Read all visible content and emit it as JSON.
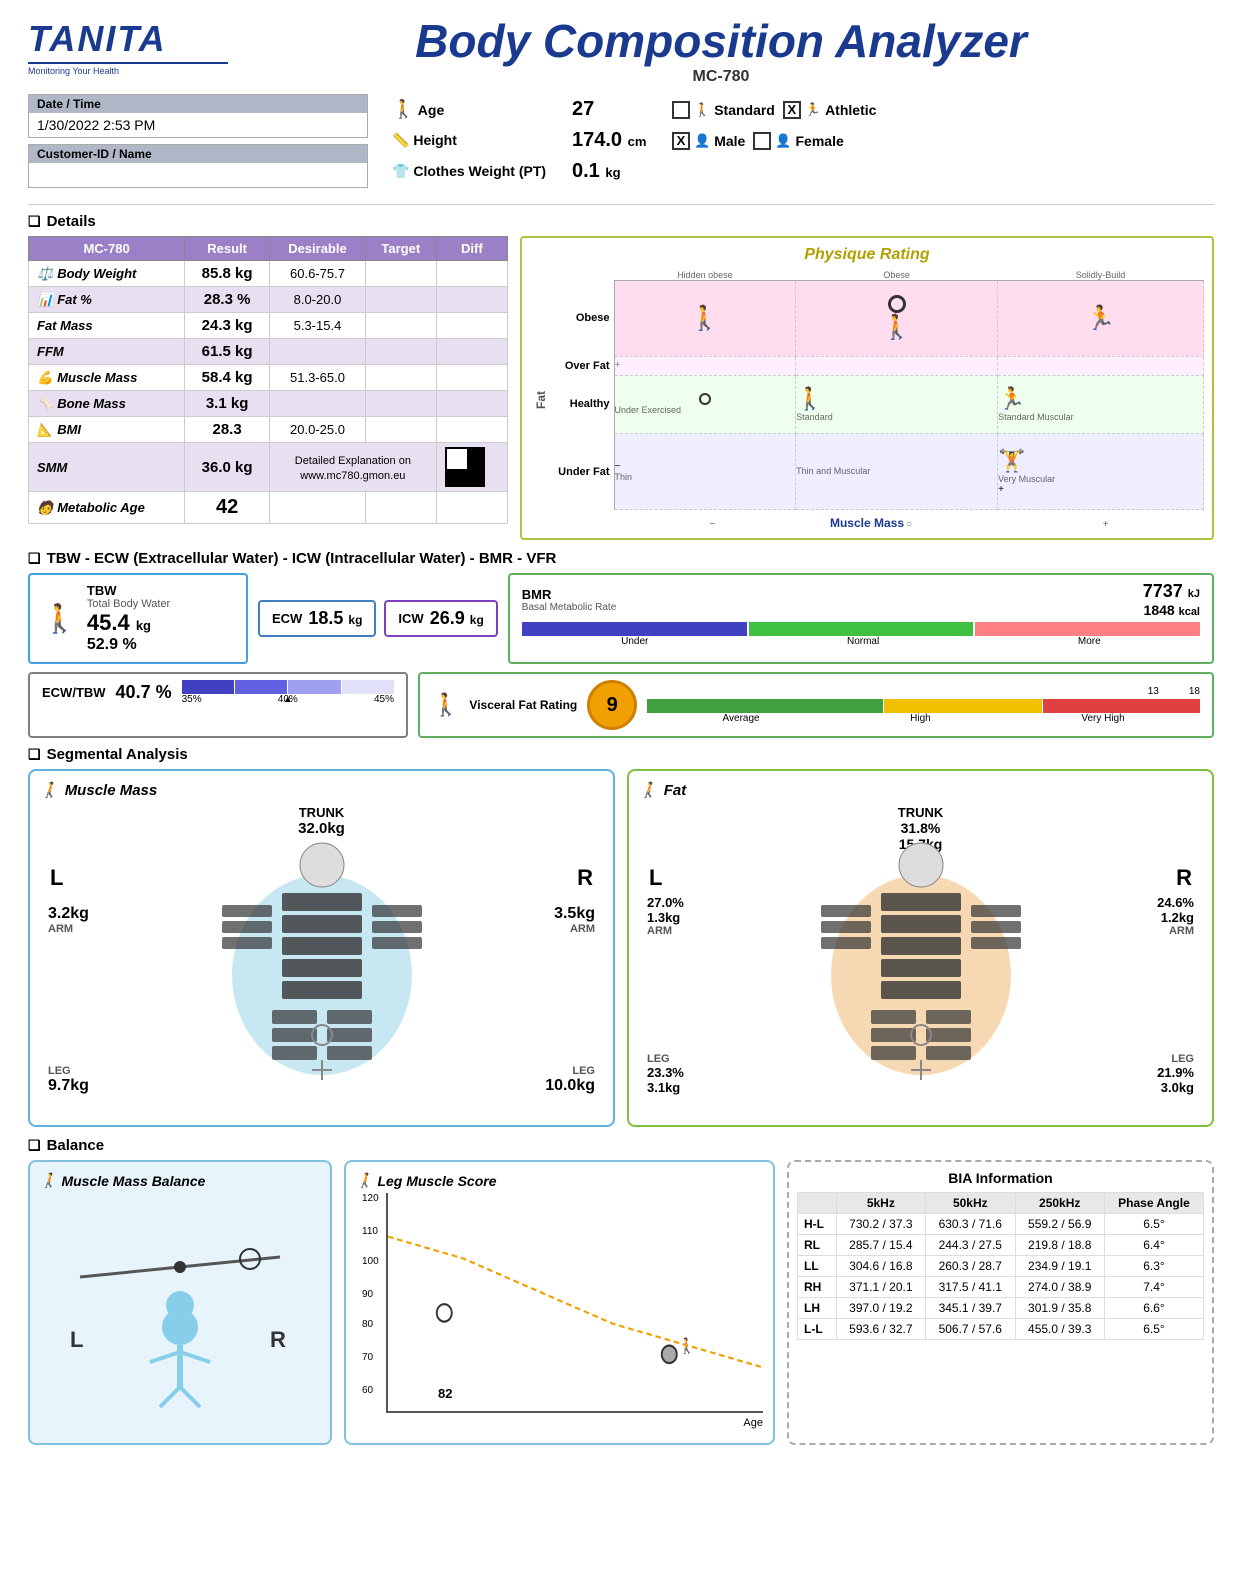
{
  "header": {
    "brand": "TANITA",
    "brand_sub": "Monitoring Your Health",
    "title": "Body Composition Analyzer",
    "model": "MC-780"
  },
  "info": {
    "date_label": "Date / Time",
    "date_value": "1/30/2022 2:53 PM",
    "customer_label": "Customer-ID / Name",
    "customer_value": "",
    "age_label": "Age",
    "age_value": "27",
    "height_label": "Height",
    "height_value": "174.0",
    "height_unit": "cm",
    "clothes_label": "Clothes Weight (PT)",
    "clothes_value": "0.1",
    "clothes_unit": "kg",
    "standard_label": "Standard",
    "athletic_label": "Athletic",
    "male_label": "Male",
    "female_label": "Female",
    "standard_checked": false,
    "athletic_checked": true,
    "male_checked": true,
    "female_checked": false
  },
  "details": {
    "section_title": "Details",
    "columns": [
      "MC-780",
      "Result",
      "Desirable",
      "Target",
      "Diff"
    ],
    "rows": [
      {
        "label": "Body Weight",
        "icon": "weight-icon",
        "result": "85.8 kg",
        "desirable": "60.6-75.7",
        "target": "",
        "diff": ""
      },
      {
        "label": "Fat %",
        "icon": "fat-pct-icon",
        "result": "28.3 %",
        "desirable": "8.0-20.0",
        "target": "",
        "diff": ""
      },
      {
        "label": "Fat Mass",
        "icon": "fat-mass-icon",
        "result": "24.3 kg",
        "desirable": "5.3-15.4",
        "target": "",
        "diff": ""
      },
      {
        "label": "FFM",
        "icon": "ffm-icon",
        "result": "61.5 kg",
        "desirable": "",
        "target": "",
        "diff": ""
      },
      {
        "label": "Muscle Mass",
        "icon": "muscle-icon",
        "result": "58.4 kg",
        "desirable": "51.3-65.0",
        "target": "",
        "diff": ""
      },
      {
        "label": "Bone Mass",
        "icon": "bone-icon",
        "result": "3.1 kg",
        "desirable": "",
        "target": "",
        "diff": ""
      },
      {
        "label": "BMI",
        "icon": "bmi-icon",
        "result": "28.3",
        "desirable": "20.0-25.0",
        "target": "",
        "diff": ""
      },
      {
        "label": "SMM",
        "icon": "smm-icon",
        "result": "36.0 kg",
        "desirable": "",
        "target": "",
        "diff": ""
      },
      {
        "label": "Metabolic Age",
        "icon": "age-icon",
        "result": "42",
        "desirable": "",
        "target": "",
        "diff": ""
      }
    ],
    "qr_note": "Detailed Explanation on www.mc780.gmon.eu"
  },
  "physique": {
    "title": "Physique Rating",
    "y_labels": [
      "Obese",
      "Over Fat",
      "Healthy",
      "Under Fat"
    ],
    "x_labels": [
      "Thin",
      "Thin and Muscular",
      "Very Muscular"
    ],
    "x_labels_top": [
      "Hidden obese",
      "Obese",
      "Solidly-Build"
    ],
    "marker_col": 2,
    "marker_row": 0,
    "fat_label": "Fat",
    "muscle_label": "Muscle Mass"
  },
  "tbw": {
    "section_title": "TBW - ECW (Extracellular Water) - ICW (Intracellular Water) - BMR - VFR",
    "tbw_label": "TBW",
    "tbw_sub": "Total Body Water",
    "tbw_value": "45.4",
    "tbw_unit": "kg",
    "tbw_pct": "52.9",
    "tbw_pct_unit": "%",
    "ecw_label": "ECW",
    "ecw_value": "18.5",
    "ecw_unit": "kg",
    "icw_label": "ICW",
    "icw_value": "26.9",
    "icw_unit": "kg",
    "bmr_label": "BMR",
    "bmr_sub": "Basal Metabolic Rate",
    "bmr_value": "7737",
    "bmr_unit": "kJ",
    "bmr_kcal": "1848",
    "bmr_kcal_unit": "kcal",
    "bmr_bar_labels": [
      "Under",
      "Normal",
      "More"
    ],
    "ecwtbw_label": "ECW/TBW",
    "ecwtbw_value": "40.7",
    "ecwtbw_unit": "%",
    "ecwtbw_bar_labels": [
      "35%",
      "40%",
      "45%"
    ],
    "visceral_label": "Visceral Fat Rating",
    "visceral_value": "9",
    "visceral_bar_markers": [
      "13",
      "18"
    ],
    "visceral_bar_labels": [
      "Average",
      "High",
      "Very High"
    ]
  },
  "segmental": {
    "section_title": "Segmental Analysis",
    "muscle_title": "Muscle Mass",
    "fat_title": "Fat",
    "trunk_label": "TRUNK",
    "l_label": "L",
    "r_label": "R",
    "arm_label": "ARM",
    "leg_label": "LEG",
    "muscle": {
      "trunk_value": "32.0kg",
      "left_arm": "3.2kg",
      "right_arm": "3.5kg",
      "left_leg": "9.7kg",
      "right_leg": "10.0kg"
    },
    "fat": {
      "trunk_pct": "31.8%",
      "trunk_value": "15.7kg",
      "left_arm_pct": "27.0%",
      "left_arm": "1.3kg",
      "right_arm_pct": "24.6%",
      "right_arm": "1.2kg",
      "left_leg_pct": "23.3%",
      "left_leg": "3.1kg",
      "right_leg_pct": "21.9%",
      "right_leg": "3.0kg"
    }
  },
  "balance": {
    "section_title": "Balance",
    "muscle_balance_title": "Muscle Mass Balance",
    "leg_score_title": "Leg Muscle Score",
    "leg_score_value": "82",
    "leg_chart_y_labels": [
      "60",
      "70",
      "80",
      "90",
      "100",
      "110",
      "120"
    ],
    "bia_title": "BIA Information",
    "bia_columns": [
      "5kHz",
      "50kHz",
      "250kHz",
      "Phase Angle"
    ],
    "bia_rows": [
      {
        "label": "H-L",
        "v5": "730.2 / 37.3",
        "v50": "630.3 / 71.6",
        "v250": "559.2 / 56.9",
        "phase": "6.5°"
      },
      {
        "label": "RL",
        "v5": "285.7 / 15.4",
        "v50": "244.3 / 27.5",
        "v250": "219.8 / 18.8",
        "phase": "6.4°"
      },
      {
        "label": "LL",
        "v5": "304.6 / 16.8",
        "v50": "260.3 / 28.7",
        "v250": "234.9 / 19.1",
        "phase": "6.3°"
      },
      {
        "label": "RH",
        "v5": "371.1 / 20.1",
        "v50": "317.5 / 41.1",
        "v250": "274.0 / 38.9",
        "phase": "7.4°"
      },
      {
        "label": "LH",
        "v5": "397.0 / 19.2",
        "v50": "345.1 / 39.7",
        "v250": "301.9 / 35.8",
        "phase": "6.6°"
      },
      {
        "label": "L-L",
        "v5": "593.6 / 32.7",
        "v50": "506.7 / 57.6",
        "v250": "455.0 / 39.3",
        "phase": "6.5°"
      }
    ]
  }
}
